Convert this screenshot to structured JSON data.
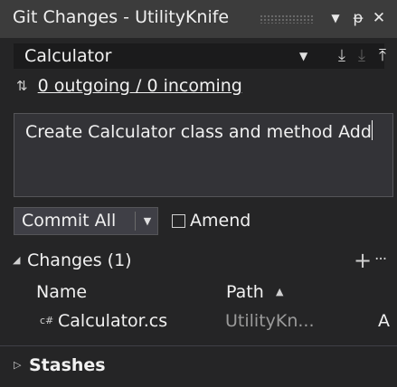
{
  "window": {
    "title": "Git Changes - UtilityKnife",
    "menu_icon": "dropdown-triangle",
    "pin_icon": "pin",
    "close_icon": "close-x"
  },
  "branch": {
    "name": "Calculator",
    "dropdown_icon": "chevron-down",
    "fetch_icon": "fetch-arrow-down",
    "pull_icon": "pull-arrow-down",
    "push_icon": "push-arrow-up"
  },
  "sync": {
    "icon": "up-down-arrows",
    "link_text": "0 outgoing / 0 incoming"
  },
  "commit_message": {
    "value": "Create Calculator class and method Add"
  },
  "commit": {
    "button_label": "Commit All",
    "amend_label": "Amend",
    "amend_checked": false
  },
  "changes": {
    "header": "Changes (1)",
    "expanded": true,
    "columns": {
      "name": "Name",
      "path": "Path"
    },
    "files": [
      {
        "icon_text": "c#",
        "name": "Calculator.cs",
        "path": "UtilityKn...",
        "status": "A"
      }
    ]
  },
  "stashes": {
    "header": "Stashes",
    "expanded": false
  }
}
